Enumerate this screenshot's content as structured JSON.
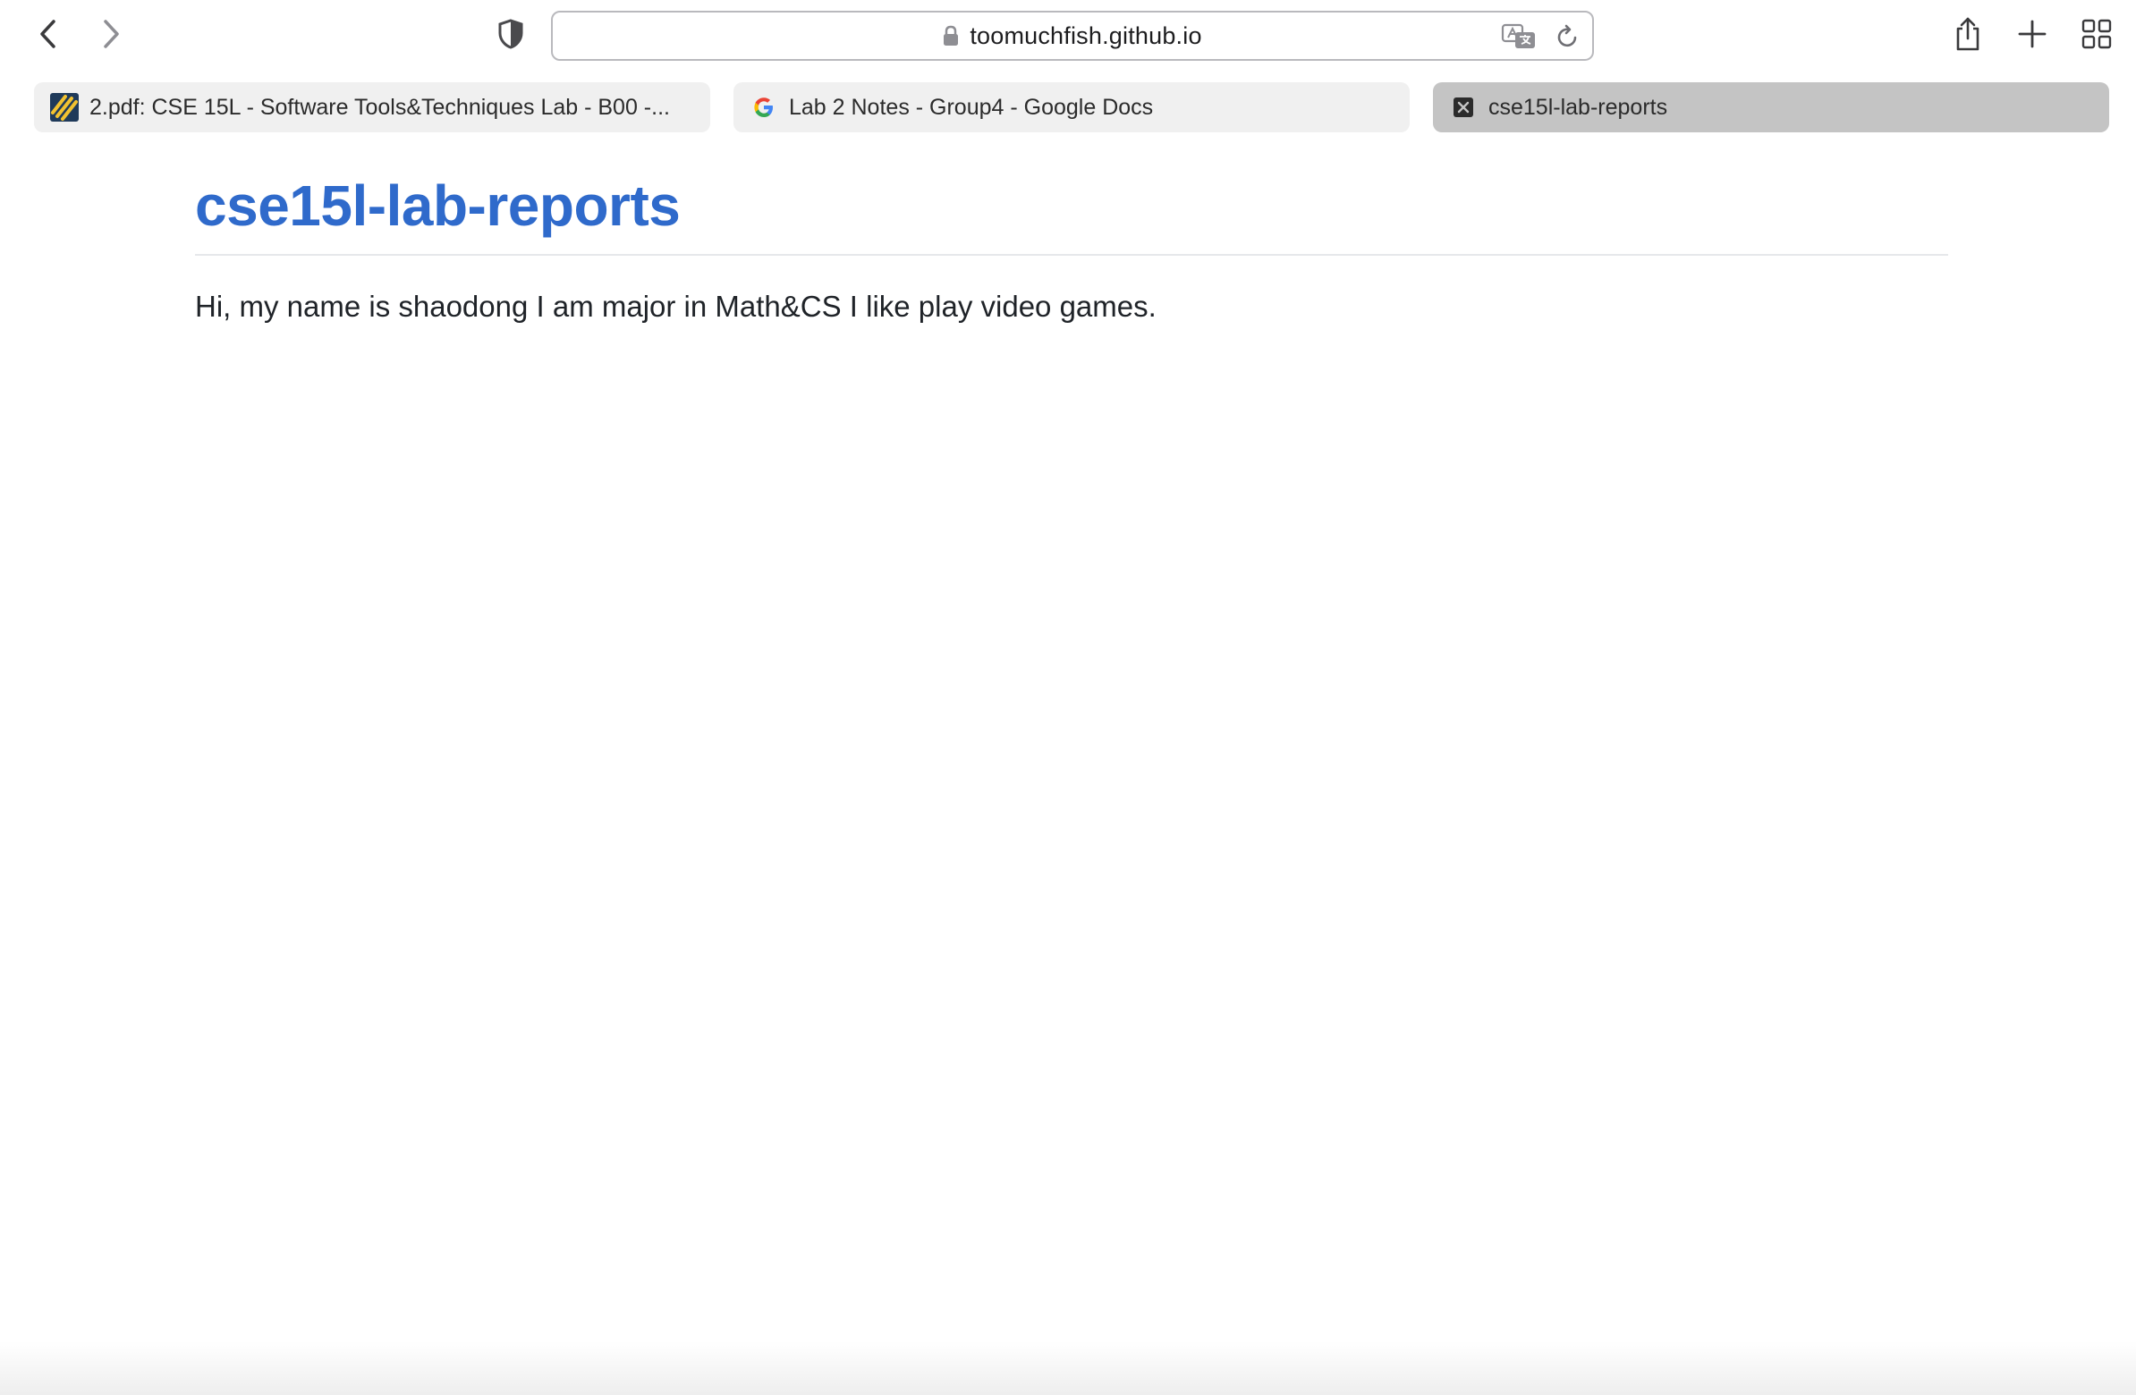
{
  "browser": {
    "address_bar": {
      "url": "toomuchfish.github.io"
    },
    "icons": {
      "back": "chevron-left-icon",
      "forward": "chevron-right-icon",
      "privacy": "shield-icon",
      "lock": "lock-icon",
      "translate": "translate-icon",
      "reload": "reload-icon",
      "share": "share-icon",
      "new_tab": "plus-icon",
      "tab_overview": "grid-icon"
    },
    "tabs": [
      {
        "title": "2.pdf: CSE 15L - Software Tools&Techniques Lab - B00 -...",
        "favicon": "gradescope-icon",
        "active": false
      },
      {
        "title": "Lab 2 Notes - Group4 - Google Docs",
        "favicon": "google-icon",
        "active": false
      },
      {
        "title": "cse15l-lab-reports",
        "favicon": "page-icon",
        "active": true
      }
    ]
  },
  "page": {
    "title": "cse15l-lab-reports",
    "paragraph": "Hi, my name is shaodong I am major in Math&CS I like play video games."
  },
  "colors": {
    "link_blue": "#2f6acb",
    "active_tab": "#c4c4c4",
    "inactive_tab": "#f0f0f0"
  }
}
